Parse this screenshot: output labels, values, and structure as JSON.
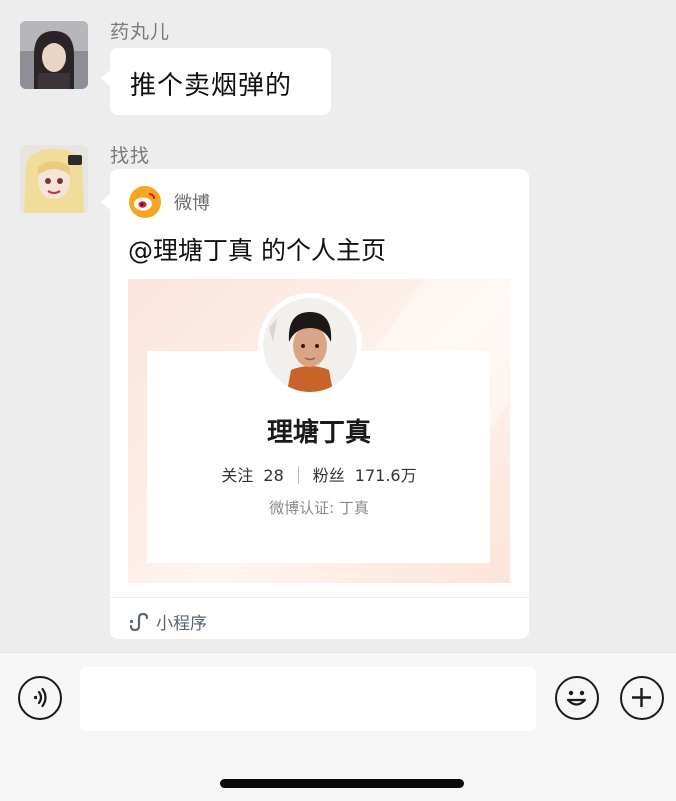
{
  "messages": [
    {
      "sender": "药丸儿",
      "text": "推个卖烟弹的",
      "avatar": "woman-portrait-avatar"
    },
    {
      "sender": "找找",
      "avatar": "anime-girl-avatar",
      "card": {
        "source": "微博",
        "source_icon": "weibo-logo-icon",
        "title": "@理塘丁真 的个人主页",
        "profile": {
          "name": "理塘丁真",
          "following_label": "关注",
          "following": "28",
          "followers_label": "粉丝",
          "followers": "171.6万",
          "verified": "微博认证: 丁真"
        },
        "footer_label": "小程序",
        "footer_icon": "mini-program-icon"
      }
    }
  ],
  "input_bar": {
    "voice_icon": "voice-icon",
    "input_value": "",
    "emoji_icon": "emoji-icon",
    "add_icon": "plus-icon"
  },
  "colors": {
    "background": "#ededed",
    "bubble": "#ffffff",
    "weibo_orange": "#f5a623",
    "weibo_red": "#e6162d"
  }
}
